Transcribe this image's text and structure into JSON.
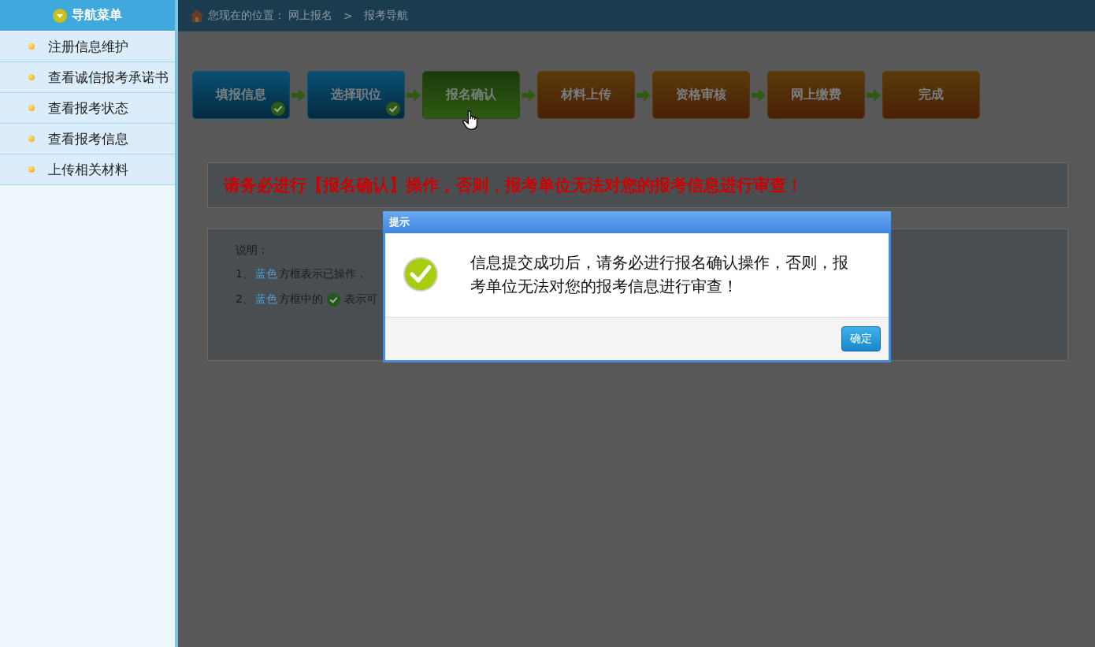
{
  "sidebar": {
    "title": "导航菜单",
    "items": [
      {
        "label": "注册信息维护"
      },
      {
        "label": "查看诚信报考承诺书"
      },
      {
        "label": "查看报考状态"
      },
      {
        "label": "查看报考信息"
      },
      {
        "label": "上传相关材料"
      }
    ]
  },
  "breadcrumb": {
    "prefix": "您现在的位置：",
    "path": [
      "网上报名",
      "报考导航"
    ],
    "separator": ">"
  },
  "steps": [
    {
      "label": "填报信息",
      "kind": "done"
    },
    {
      "label": "选择职位",
      "kind": "done"
    },
    {
      "label": "报名确认",
      "kind": "current"
    },
    {
      "label": "材料上传",
      "kind": "pending"
    },
    {
      "label": "资格审核",
      "kind": "pending"
    },
    {
      "label": "网上缴费",
      "kind": "pending"
    },
    {
      "label": "完成",
      "kind": "pending"
    }
  ],
  "notice": "请务必进行【报名确认】操作，否则，报考单位无法对您的报考信息进行审查！",
  "notes": {
    "title": "说明：",
    "lines": [
      {
        "parts": [
          {
            "kind": "text",
            "text": "1、"
          },
          {
            "kind": "highlight",
            "text": "蓝色"
          },
          {
            "kind": "text",
            "text": "方框表示已操作，"
          }
        ]
      },
      {
        "parts": [
          {
            "kind": "text",
            "text": "2、"
          },
          {
            "kind": "highlight",
            "text": "蓝色"
          },
          {
            "kind": "text",
            "text": "方框中的"
          },
          {
            "kind": "check"
          },
          {
            "kind": "text",
            "text": "表示可"
          }
        ]
      }
    ]
  },
  "dialog": {
    "title": "提示",
    "message": "信息提交成功后，请务必进行报名确认操作，否则，报考单位无法对您的报考信息进行审查！",
    "button": "确定"
  }
}
